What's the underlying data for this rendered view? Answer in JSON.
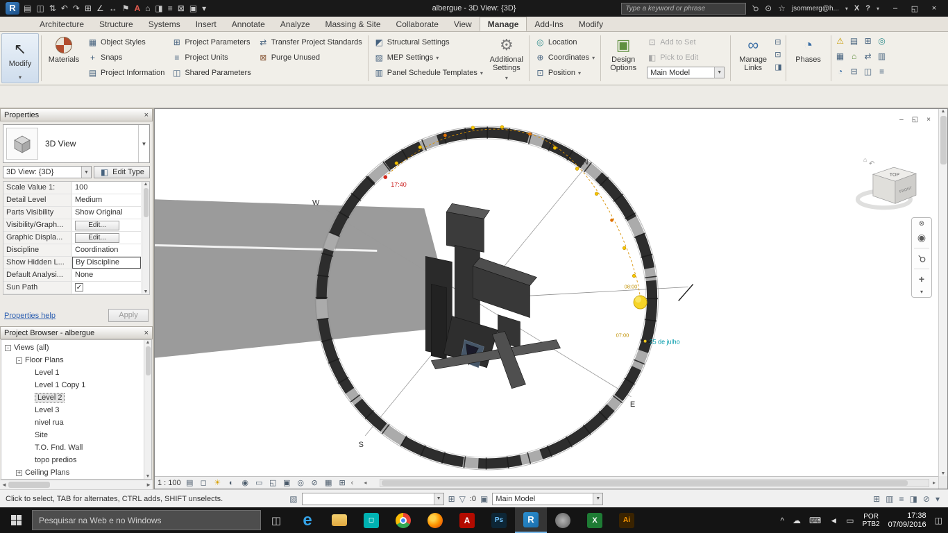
{
  "titlebar": {
    "title": "albergue - 3D View: {3D}",
    "search_placeholder": "Type a keyword or phrase",
    "user": "jsommerg@h..."
  },
  "tabs": [
    "Architecture",
    "Structure",
    "Systems",
    "Insert",
    "Annotate",
    "Analyze",
    "Massing & Site",
    "Collaborate",
    "View",
    "Manage",
    "Add-Ins",
    "Modify"
  ],
  "active_tab": "Manage",
  "ribbon": {
    "modify": "Modify",
    "materials": "Materials",
    "object_styles": "Object Styles",
    "snaps": "Snaps",
    "project_information": "Project Information",
    "project_parameters": "Project Parameters",
    "project_units": "Project Units",
    "shared_parameters": "Shared Parameters",
    "transfer_project_standards": "Transfer Project Standards",
    "purge_unused": "Purge Unused",
    "structural_settings": "Structural Settings",
    "mep_settings": "MEP Settings",
    "panel_schedule_templates": "Panel Schedule Templates",
    "additional_settings": "Additional Settings",
    "location": "Location",
    "coordinates": "Coordinates",
    "position": "Position",
    "design_options": "Design Options",
    "add_to_set": "Add to Set",
    "pick_to_edit": "Pick to Edit",
    "active_design_option": "Main Model",
    "manage_links": "Manage Links",
    "phases": "Phases"
  },
  "properties": {
    "header": "Properties",
    "type_name": "3D View",
    "view_selector": "3D View: {3D}",
    "edit_type": "Edit Type",
    "rows": [
      {
        "label": "Scale Value    1:",
        "value": "100"
      },
      {
        "label": "Detail Level",
        "value": "Medium"
      },
      {
        "label": "Parts Visibility",
        "value": "Show Original"
      },
      {
        "label": "Visibility/Graph...",
        "value": "Edit..."
      },
      {
        "label": "Graphic Displa...",
        "value": "Edit..."
      },
      {
        "label": "Discipline",
        "value": "Coordination"
      },
      {
        "label": "Show Hidden L...",
        "value": "By Discipline"
      },
      {
        "label": "Default Analysi...",
        "value": "None"
      },
      {
        "label": "Sun Path",
        "value": "✓"
      }
    ],
    "help_link": "Properties help",
    "apply_button": "Apply"
  },
  "browser": {
    "header": "Project Browser - albergue",
    "views_root": "Views (all)",
    "floor_plans": "Floor Plans",
    "levels": [
      "Level 1",
      "Level 1 Copy 1",
      "Level 2",
      "Level 3",
      "nivel rua",
      "Site",
      "T.O. Fnd. Wall",
      "topo predios"
    ],
    "selected": "Level 2",
    "ceiling_plans": "Ceiling Plans"
  },
  "viewport": {
    "compass_n": "N",
    "compass_s": "S",
    "compass_e": "E",
    "compass_w": "W",
    "sunset_time": "17:40",
    "sunrise_time": "07:00",
    "sun_hour_label": "08:00",
    "date_label": "25 de julho",
    "viewcube_top": "TOP",
    "viewcube_front": "FRONT"
  },
  "view_control_bar": {
    "scale": "1 : 100"
  },
  "statusbar": {
    "message": "Click to select, TAB for alternates, CTRL adds, SHIFT unselects.",
    "selection_count": ":0",
    "design_option": "Main Model"
  },
  "taskbar": {
    "search_placeholder": "Pesquisar na Web e no Windows",
    "language": "POR",
    "keyboard": "PTB2",
    "time": "17:38",
    "date": "07/09/2016"
  },
  "colors": {
    "accent_blue": "#2b79c2",
    "sun_yellow": "#f2c81c",
    "date_cyan": "#00a0b0",
    "time_red": "#cc2020"
  }
}
